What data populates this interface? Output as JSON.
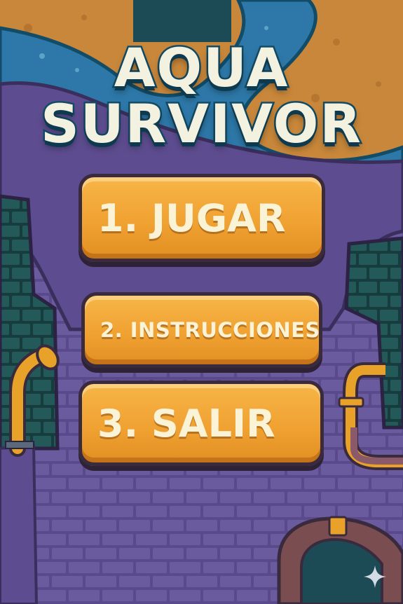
{
  "game": {
    "title_line1": "AQUA",
    "title_line2": "SURVIVOR"
  },
  "menu": [
    {
      "label": "1. JUGAR"
    },
    {
      "label": "2. INSTRUCCIONES"
    },
    {
      "label": "3. SALIR"
    }
  ],
  "colors": {
    "title_fill": "#f3f1df",
    "title_outline": "#124c66",
    "button_fill": "#f0a232",
    "button_border": "#3a2a3e",
    "button_text": "#fbf3d6",
    "wall_purple": "#5a4a8c",
    "sand": "#c8873a",
    "water": "#2d78a8",
    "dark_teal_bricks": "#1f4f4f",
    "pipe_orange": "#e8a22a"
  }
}
